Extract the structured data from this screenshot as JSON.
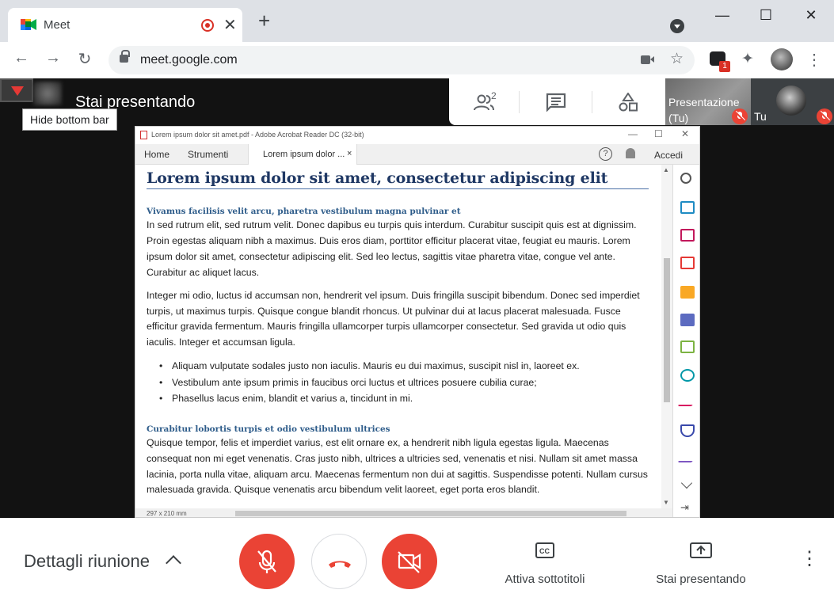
{
  "browser": {
    "tab_title": "Meet",
    "close_glyph": "✕",
    "new_tab_glyph": "+",
    "url": "meet.google.com",
    "extension_badge": "1",
    "window_controls": {
      "minimize": "—",
      "maximize": "☐",
      "close": "✕"
    },
    "nav": {
      "back": "←",
      "forward": "→",
      "reload": "↻"
    },
    "star": "☆",
    "puzzle": "✦",
    "menu": "⋮"
  },
  "meet": {
    "presenting_title": "Stai presentando",
    "tooltip": "Hide bottom bar",
    "people_count": "2",
    "tiles": {
      "presentation_name": "Presentazione (Tu)",
      "self_name": "Tu"
    },
    "bottom": {
      "details_label": "Dettagli riunione",
      "captions_label": "Attiva sottotitoli",
      "presenting_label": "Stai presentando",
      "more_glyph": "⋮"
    },
    "colors": {
      "red": "#ea4335",
      "accent": "#1a73e8"
    }
  },
  "acrobat": {
    "window_title": "Lorem ipsum dolor sit amet.pdf - Adobe Acrobat Reader DC (32-bit)",
    "win": {
      "min": "—",
      "max": "☐",
      "close": "✕"
    },
    "menu": {
      "home": "Home",
      "tools": "Strumenti",
      "doc_tab": "Lorem ipsum dolor ...",
      "doc_tab_close": "×",
      "help": "?",
      "signin": "Accedi"
    },
    "page_size": "297 x 210 mm",
    "document": {
      "title": "Lorem ipsum dolor sit amet, consectetur adipiscing elit",
      "h1": "Vivamus facilisis velit arcu, pharetra vestibulum magna pulvinar et",
      "p1": "In sed rutrum elit, sed rutrum velit. Donec dapibus eu turpis quis interdum. Curabitur suscipit quis est at dignissim. Proin egestas aliquam nibh a maximus. Duis eros diam, porttitor efficitur placerat vitae, feugiat eu mauris. Lorem ipsum dolor sit amet, consectetur adipiscing elit. Sed leo lectus, sagittis vitae pharetra vitae, congue vel ante. Curabitur ac aliquet lacus.",
      "p2": "Integer mi odio, luctus id accumsan non, hendrerit vel ipsum. Duis fringilla suscipit bibendum. Donec sed imperdiet turpis, ut maximus turpis. Quisque congue blandit rhoncus. Ut pulvinar dui at lacus placerat malesuada. Fusce efficitur gravida fermentum. Mauris fringilla ullamcorper turpis ullamcorper consectetur. Sed gravida ut odio quis iaculis. Integer et accumsan ligula.",
      "bullets": [
        "Aliquam vulputate sodales justo non iaculis. Mauris eu dui maximus, suscipit nisl in, laoreet ex.",
        "Vestibulum ante ipsum primis in faucibus orci luctus et ultrices posuere cubilia curae;",
        "Phasellus lacus enim, blandit et varius a, tincidunt in mi."
      ],
      "h2": "Curabitur lobortis turpis et odio vestibulum ultrices",
      "p3": "Quisque tempor, felis et imperdiet varius, est elit ornare ex, a hendrerit nibh ligula egestas ligula. Maecenas consequat non mi eget venenatis. Cras justo nibh, ultrices a ultricies sed, venenatis et nisi. Nullam sit amet massa lacinia, porta nulla vitae, aliquam arcu. Maecenas fermentum non dui at sagittis. Suspendisse potenti. Nullam cursus malesuada gravida. Quisque venenatis arcu bibendum velit laoreet, eget porta eros blandit."
    },
    "tool_icons": [
      "zoom-icon",
      "export-pdf-icon",
      "organize-pages-icon",
      "create-pdf-icon",
      "comment-icon",
      "combine-files-icon",
      "edit-pdf-icon",
      "send-for-review-icon",
      "fill-sign-icon",
      "protect-icon",
      "request-signature-icon",
      "expand-tools-icon",
      "collapse-pane-icon"
    ]
  }
}
